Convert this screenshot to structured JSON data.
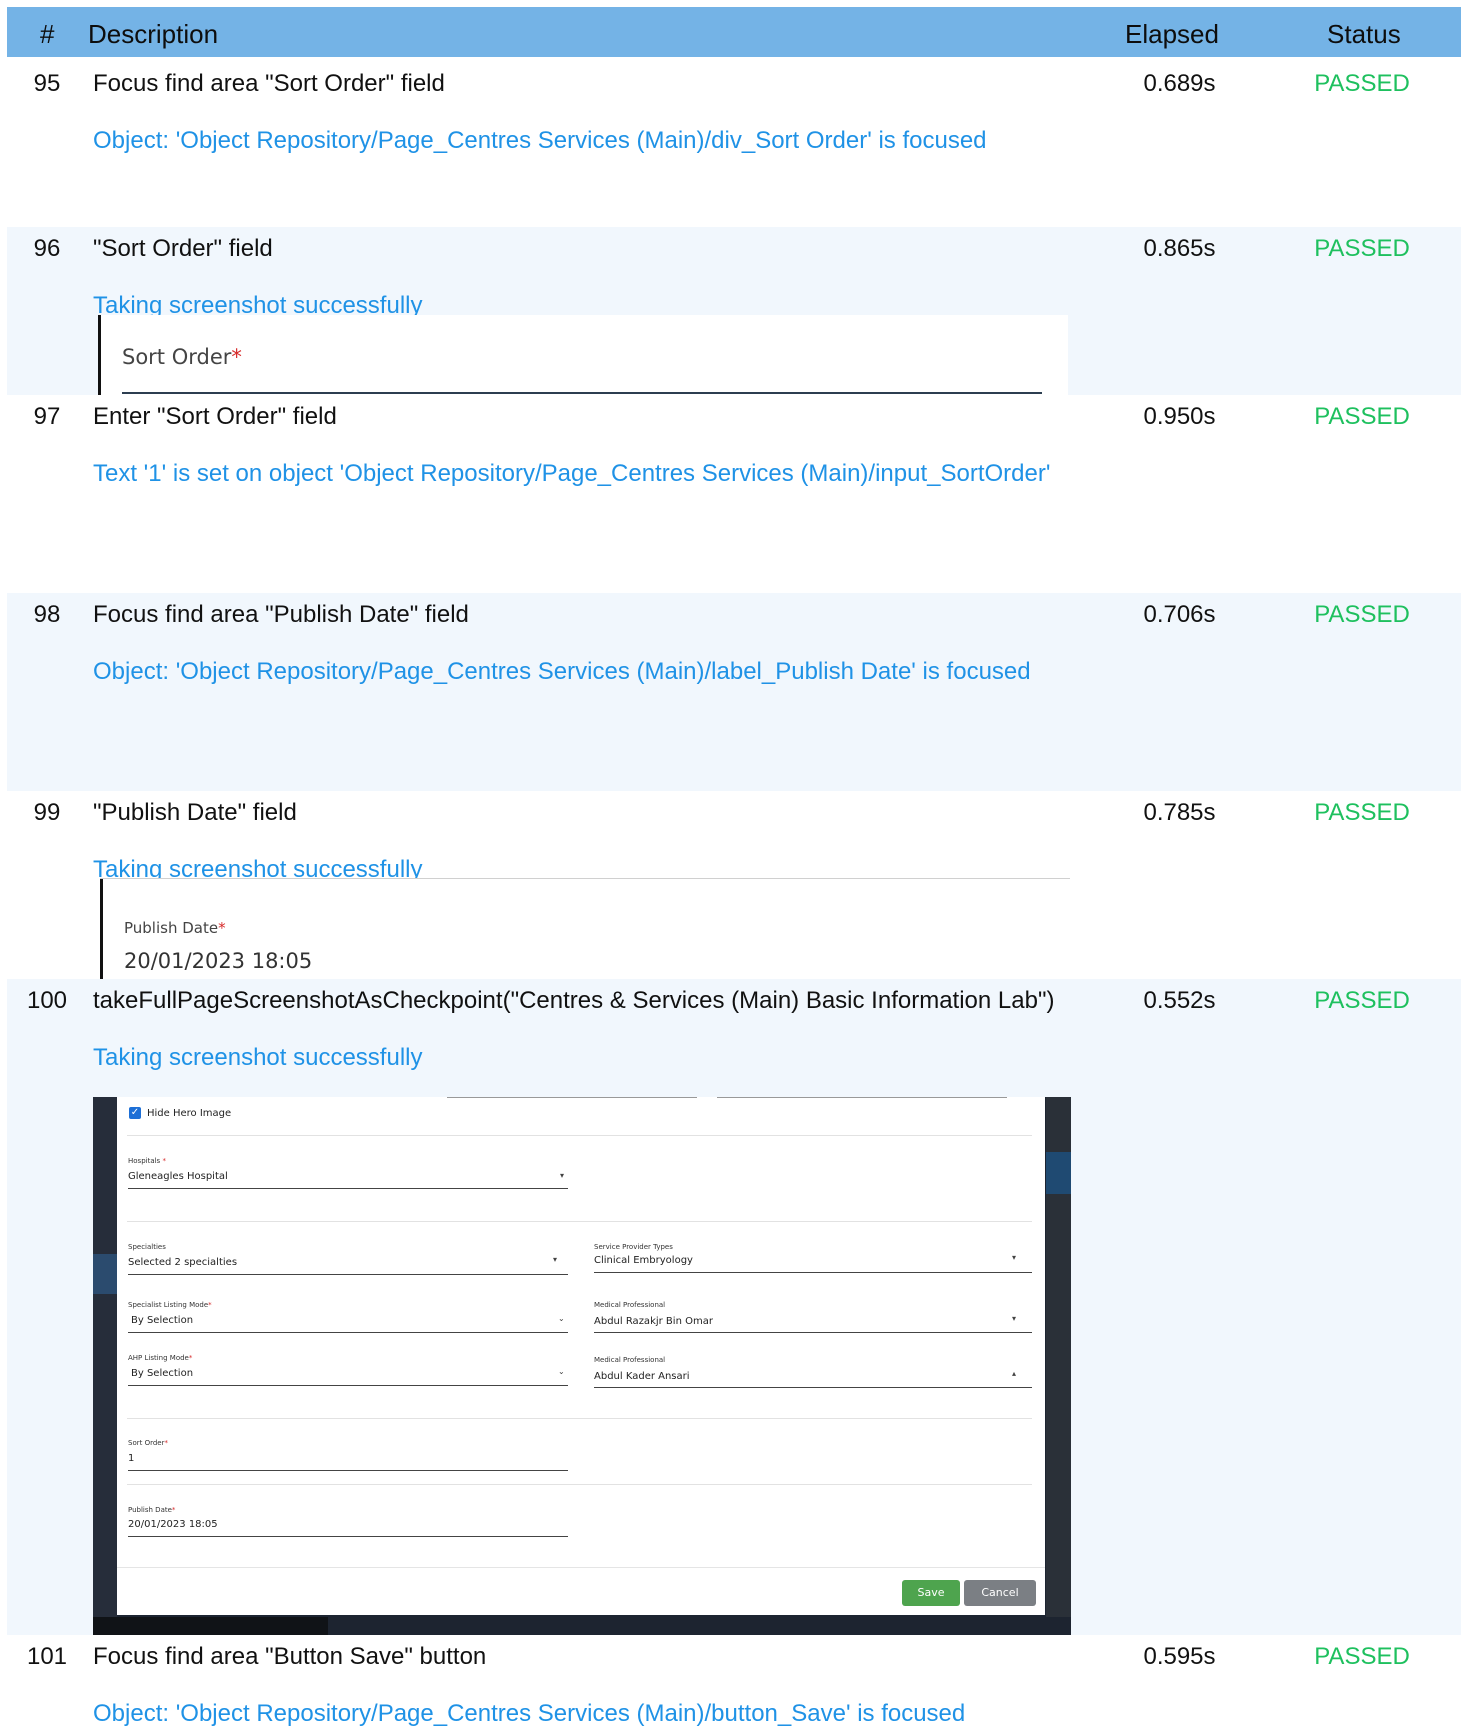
{
  "header": {
    "num": "#",
    "description": "Description",
    "elapsed": "Elapsed",
    "status": "Status"
  },
  "rows": [
    {
      "num": "95",
      "description": "Focus find area \"Sort Order\" field",
      "elapsed": "0.689s",
      "status": "PASSED",
      "log": "Object: 'Object Repository/Page_Centres  Services (Main)/div_Sort Order' is focused"
    },
    {
      "num": "96",
      "description": "\"Sort Order\" field",
      "elapsed": "0.865s",
      "status": "PASSED",
      "log": "Taking screenshot successfully",
      "snapshot": {
        "label": "Sort Order",
        "required": "*"
      }
    },
    {
      "num": "97",
      "description": "Enter \"Sort Order\" field",
      "elapsed": "0.950s",
      "status": "PASSED",
      "log": "Text '1' is set on object 'Object Repository/Page_Centres  Services (Main)/input_SortOrder'"
    },
    {
      "num": "98",
      "description": "Focus find area \"Publish Date\" field",
      "elapsed": "0.706s",
      "status": "PASSED",
      "log": "Object: 'Object Repository/Page_Centres  Services (Main)/label_Publish Date' is focused"
    },
    {
      "num": "99",
      "description": "\"Publish Date\" field",
      "elapsed": "0.785s",
      "status": "PASSED",
      "log": "Taking screenshot successfully",
      "snapshot": {
        "label": "Publish Date",
        "required": "*",
        "value": "20/01/2023 18:05"
      }
    },
    {
      "num": "100",
      "description": "takeFullPageScreenshotAsCheckpoint(\"Centres & Services (Main) Basic Information Lab\")",
      "elapsed": "0.552s",
      "status": "PASSED",
      "log": "Taking screenshot successfully"
    },
    {
      "num": "101",
      "description": "Focus find area \"Button Save\" button",
      "elapsed": "0.595s",
      "status": "PASSED",
      "log": "Object: 'Object Repository/Page_Centres  Services (Main)/button_Save' is focused"
    }
  ],
  "fullpage": {
    "hide_hero": "Hide Hero Image",
    "hospitals_label": "Hospitals",
    "hospitals_value": "Gleneagles Hospital",
    "specialties_label": "Specialties",
    "specialties_value": "Selected 2 specialties",
    "service_types_label": "Service Provider Types",
    "service_types_value": "Clinical Embryology",
    "specialist_mode_label": "Specialist Listing Mode",
    "specialist_mode_value": "By Selection",
    "medical_prof_label": "Medical Professional",
    "medical_prof_value_1": "Abdul Razakjr Bin Omar",
    "ahp_mode_label": "AHP Listing Mode",
    "ahp_mode_value": "By Selection",
    "medical_prof_value_2": "Abdul Kader Ansari",
    "sort_order_label": "Sort Order",
    "sort_order_value": "1",
    "publish_date_label": "Publish Date",
    "publish_date_value": "20/01/2023 18:05",
    "save": "Save",
    "cancel": "Cancel",
    "colors": {
      "save": "#4ea44e",
      "cancel": "#7b7f84",
      "checkbox": "#1d6fd6"
    }
  },
  "colors": {
    "header_bg": "#74b3e6",
    "passed": "#1ec05e",
    "log": "#1f92e6",
    "alt_row": "#f1f7fd"
  }
}
